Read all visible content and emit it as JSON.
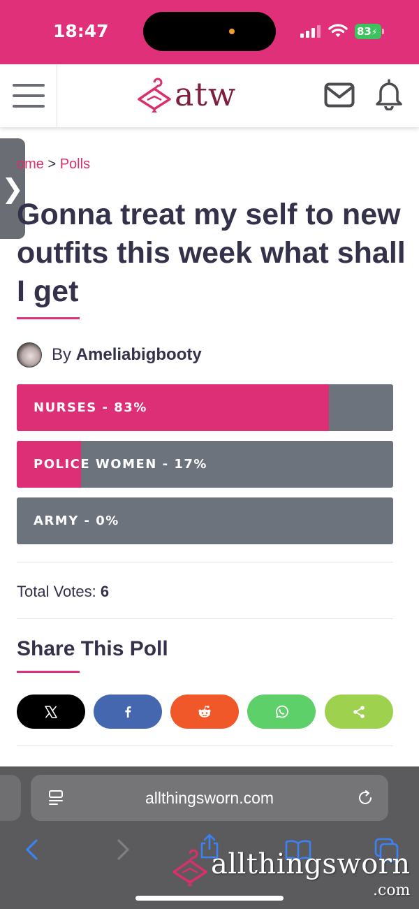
{
  "status_bar": {
    "time": "18:47",
    "battery": "83"
  },
  "header": {
    "logo_text": "atw",
    "icons": [
      "menu-icon",
      "mail-icon",
      "bell-icon"
    ]
  },
  "side_tab": {
    "glyph": "❯"
  },
  "breadcrumb": {
    "home": "ome",
    "separator": ">",
    "current": "Polls"
  },
  "poll": {
    "title": "Gonna treat my self to new outfits this week what shall I get",
    "author_prefix": "By",
    "author": "Ameliabigbooty",
    "options": [
      {
        "label": "NURSES - 83%",
        "percent": 83
      },
      {
        "label": "POLICE WOMEN - 17%",
        "percent": 17
      },
      {
        "label": "ARMY - 0%",
        "percent": 0
      }
    ],
    "total_votes_label": "Total Votes:",
    "total_votes": "6"
  },
  "share": {
    "title": "Share This Poll",
    "buttons": [
      {
        "name": "x",
        "icon": "x-logo-icon",
        "color": "#000000"
      },
      {
        "name": "facebook",
        "icon": "facebook-icon",
        "color": "#4467b0"
      },
      {
        "name": "reddit",
        "icon": "reddit-icon",
        "color": "#f0582a"
      },
      {
        "name": "whatsapp",
        "icon": "whatsapp-icon",
        "color": "#5ed06a"
      },
      {
        "name": "share",
        "icon": "share-icon",
        "color": "#9ed14e"
      }
    ]
  },
  "browser": {
    "url": "allthingsworn.com"
  },
  "watermark": {
    "text": "allthingsworn",
    "suffix": ".com"
  },
  "colors": {
    "brand_pink": "#e0307a",
    "poll_fill": "#dd2f76",
    "poll_track": "#6c737c",
    "text_dark": "#34314a"
  }
}
